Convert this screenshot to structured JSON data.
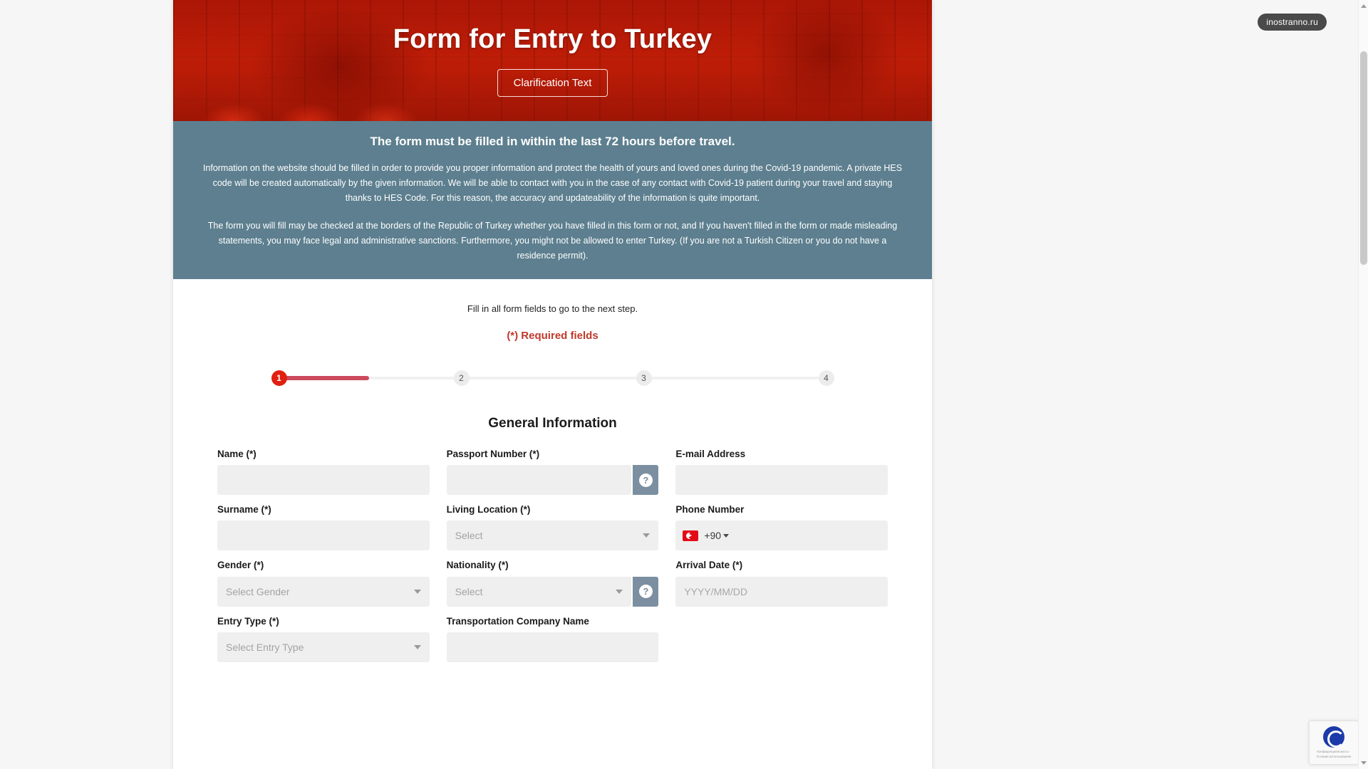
{
  "site_badge": "inostranno.ru",
  "hero": {
    "title": "Form for Entry to Turkey",
    "clarification_button": "Clarification Text"
  },
  "info_banner": {
    "headline": "The form must be filled in within the last 72 hours before travel.",
    "paragraph_1": "Information on the website should be filled in order to provide you proper information and protect the health of yours and loved ones during the Covid-19 pandemic. A private HES code will be created automatically by the given information. We will be able to contact with you in the case of any contact with Covid-19 patient during your travel and staying thanks to HES Code. For this reason, the accuracy and updateability of the information is quite important.",
    "paragraph_2": "The form you will fill may be checked at the borders of the Republic of Turkey whether you have filled in this form or not, and If you haven't filled in the form or made misleading statements, you may face legal and administrative sanctions. Furthermore, you might not be allowed to enter Turkey. (If you are not a Turkish Citizen or you do not have a residence permit)."
  },
  "form": {
    "hint": "Fill in all form fields to go to the next step.",
    "required_note": "(*) Required fields",
    "section_title": "General Information",
    "stepper": {
      "steps": [
        "1",
        "2",
        "3",
        "4"
      ],
      "active_index": 0,
      "active_color": "#e01f10",
      "fill_color": "#cb4a5c",
      "track_color": "#f1f1f1"
    },
    "fields": {
      "name": {
        "label": "Name (*)",
        "value": "",
        "placeholder": ""
      },
      "passport_number": {
        "label": "Passport Number (*)",
        "value": "",
        "placeholder": "",
        "help_icon": "question-mark-icon"
      },
      "email": {
        "label": "E-mail Address",
        "value": "",
        "placeholder": ""
      },
      "surname": {
        "label": "Surname (*)",
        "value": "",
        "placeholder": ""
      },
      "living_location": {
        "label": "Living Location (*)",
        "selected": "Select"
      },
      "phone": {
        "label": "Phone Number",
        "country_flag": "turkey-flag-icon",
        "dial_code": "+90",
        "value": "",
        "placeholder": ""
      },
      "gender": {
        "label": "Gender (*)",
        "selected": "Select Gender"
      },
      "nationality": {
        "label": "Nationality (*)",
        "selected": "Select",
        "help_icon": "question-mark-icon"
      },
      "arrival_date": {
        "label": "Arrival Date (*)",
        "value": "",
        "placeholder": "YYYY/MM/DD"
      },
      "entry_type": {
        "label": "Entry Type (*)",
        "selected": "Select Entry Type"
      },
      "transportation_company": {
        "label": "Transportation Company Name",
        "value": "",
        "placeholder": ""
      }
    }
  },
  "recaptcha": {
    "privacy_terms": "Конфиденциальность - Условия использования"
  },
  "colors": {
    "hero_red": "#c9310f",
    "banner_blue": "#5d7f8f",
    "required_red": "#c0392b",
    "help_button": "#7b8fa0",
    "input_bg": "#efefef"
  }
}
